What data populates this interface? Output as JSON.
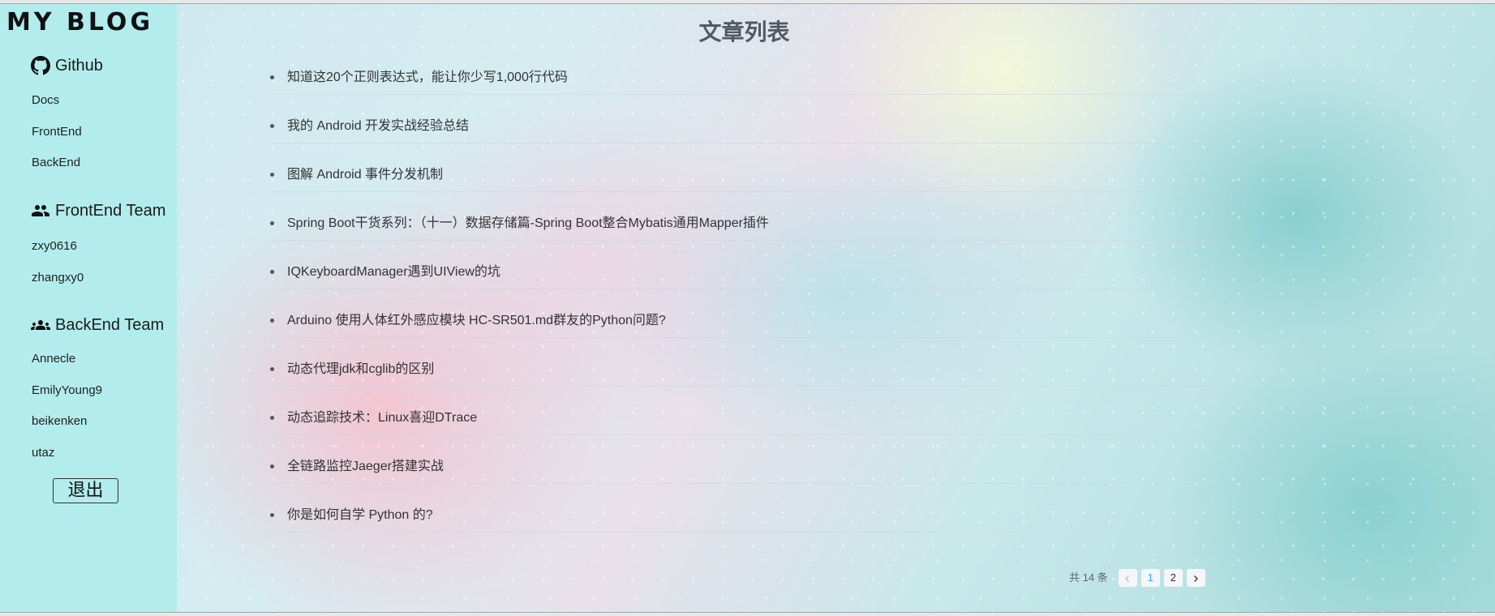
{
  "sidebar": {
    "logo": "MY BLOG",
    "groups": [
      {
        "title": "Github",
        "icon": "github-icon",
        "items": [
          "Docs",
          "FrontEnd",
          "BackEnd"
        ]
      },
      {
        "title": "FrontEnd Team",
        "icon": "group-icon",
        "items": [
          "zxy0616",
          "zhangxy0"
        ]
      },
      {
        "title": "BackEnd Team",
        "icon": "team-icon",
        "items": [
          "Annecle",
          "EmilyYoung9",
          "beikenken",
          "utaz"
        ]
      }
    ],
    "logout_label": "退出"
  },
  "main": {
    "title": "文章列表",
    "posts": [
      "知道这20个正则表达式，能让你少写1,000行代码",
      "我的 Android 开发实战经验总结",
      "图解 Android 事件分发机制",
      "Spring Boot干货系列：（十一）数据存储篇-Spring Boot整合Mybatis通用Mapper插件",
      "IQKeyboardManager遇到UIView的坑",
      "Arduino 使用人体红外感应模块 HC-SR501.md群友的Python问题?",
      "动态代理jdk和cglib的区别",
      "动态追踪技术：Linux喜迎DTrace",
      "全链路监控Jaeger搭建实战",
      "你是如何自学 Python 的?"
    ]
  },
  "pagination": {
    "total_text": "共 14 条",
    "pages": [
      "1",
      "2"
    ],
    "current_page": "1",
    "prev_icon": "chevron-left-icon",
    "next_icon": "chevron-right-icon"
  },
  "colors": {
    "sidebar_bg": "#b2ecec",
    "title": "#505a66",
    "active_page": "#409eff"
  }
}
